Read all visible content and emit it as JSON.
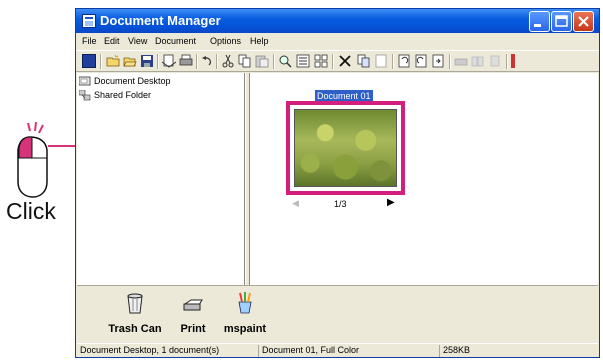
{
  "window": {
    "title": "Document Manager",
    "caption_buttons": [
      "minimize",
      "maximize",
      "close"
    ]
  },
  "menu": {
    "items": [
      "File",
      "Edit",
      "View",
      "Document",
      "Options",
      "Help"
    ]
  },
  "toolbar": {
    "icons": [
      "app-icon",
      "new-folder-icon",
      "open-folder-icon",
      "save-icon",
      "print-preview-icon",
      "print-icon",
      "undo-icon",
      "cut-icon",
      "copy-icon",
      "paste-icon",
      "search-icon",
      "view-details-icon",
      "view-thumbnails-icon",
      "delete-icon",
      "copy-page-icon",
      "blank-page-icon",
      "rotate-left-icon",
      "rotate-right-icon",
      "rotate-icon",
      "print-disabled-icon",
      "pages-disabled-icon",
      "page-disabled-icon"
    ]
  },
  "tree": {
    "items": [
      {
        "label": "Document Desktop",
        "icon": "desktop-icon"
      },
      {
        "label": "Shared Folder",
        "icon": "shared-folder-icon"
      }
    ]
  },
  "document": {
    "name": "Document 01",
    "page_indicator": "1/3",
    "prev_arrow": "◀",
    "next_arrow": "▶"
  },
  "apps": {
    "items": [
      {
        "label": "Trash Can",
        "icon": "trash-can-icon"
      },
      {
        "label": "Print",
        "icon": "printer-icon"
      },
      {
        "label": "mspaint",
        "icon": "paint-brushes-icon"
      }
    ]
  },
  "status": {
    "location": "Document Desktop, 1 document(s)",
    "document": "Document 01, Full Color",
    "size": "258KB"
  },
  "callout": {
    "label": "Click",
    "icon": "mouse-left-click-icon"
  },
  "colors": {
    "title_bar": "#0a5ee0",
    "selection_frame": "#d3207c",
    "callout_line": "#d6337a",
    "window_face": "#ece9d8"
  }
}
